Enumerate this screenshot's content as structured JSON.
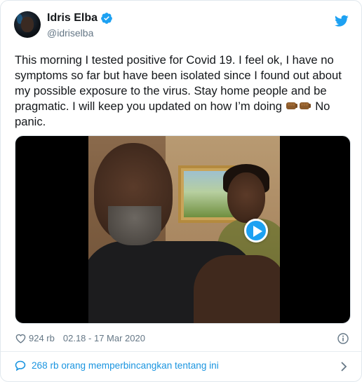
{
  "author": {
    "display_name": "Idris Elba",
    "handle": "@idriselba",
    "verified": true
  },
  "tweet": {
    "text_main": "This morning I tested positive for Covid 19. I feel ok, I have no symptoms so far but have been isolated since I found out about my possible exposure to the virus.  Stay home people and be pragmatic. I will keep you updated on how I’m doing",
    "text_tail": "No panic.",
    "emoji": [
      "fist-bump-emoji",
      "fist-bump-emoji"
    ]
  },
  "media": {
    "type": "video",
    "play_icon": "play-icon"
  },
  "meta": {
    "likes": "924 rb",
    "timestamp": "02.18 - 17 Mar 2020"
  },
  "discussion": {
    "label": "268 rb orang memperbincangkan tentang ini"
  },
  "colors": {
    "accent": "#1da1f2",
    "link": "#1b95e0",
    "secondary_text": "#657786",
    "text": "#14171a"
  },
  "icons": [
    "verified-badge-icon",
    "twitter-logo-icon",
    "heart-icon",
    "info-icon",
    "speech-bubble-icon",
    "chevron-right-icon",
    "play-icon"
  ]
}
